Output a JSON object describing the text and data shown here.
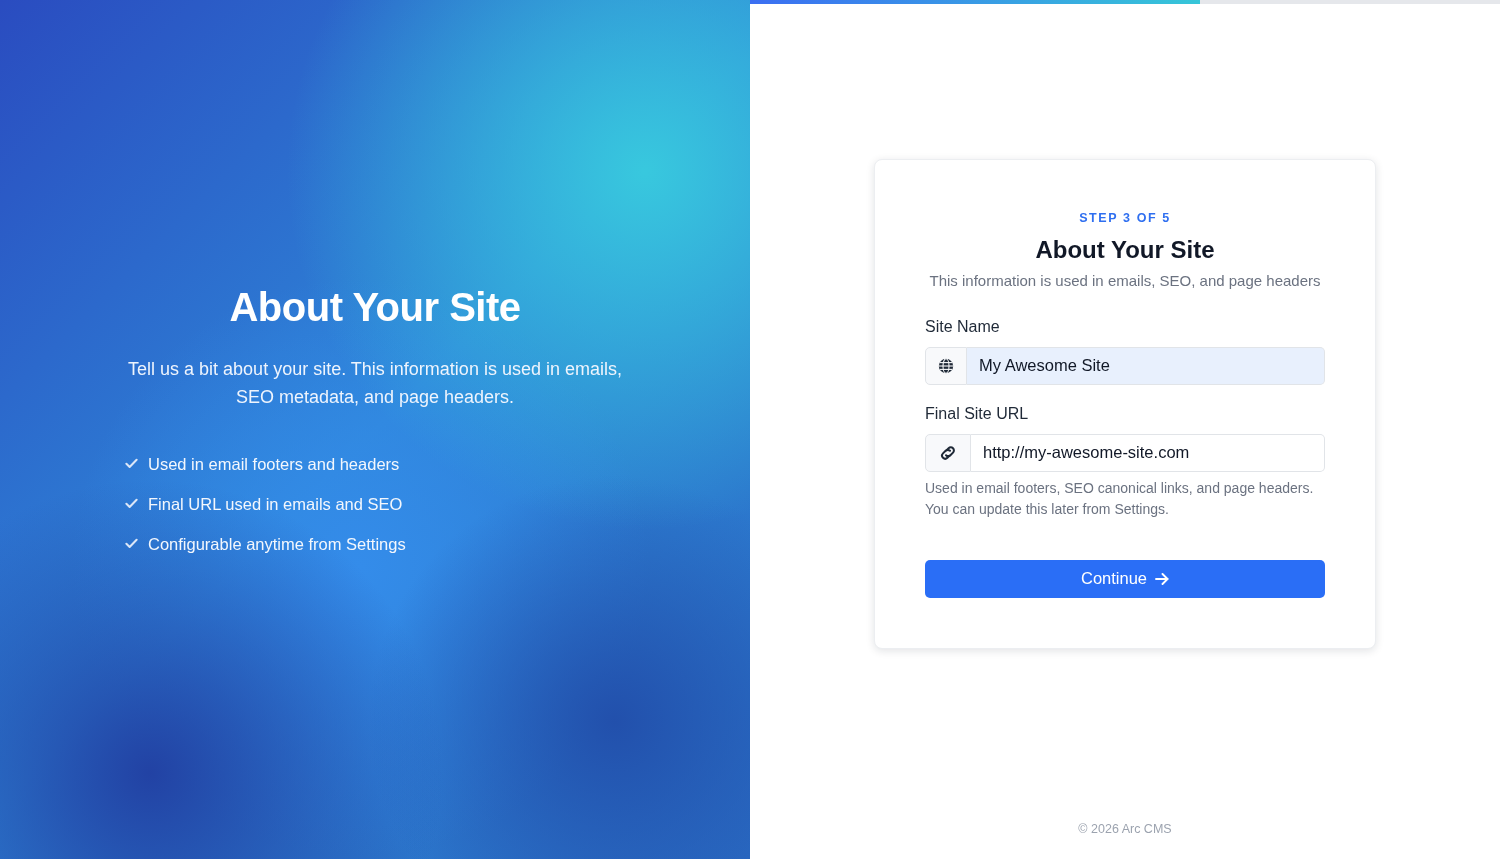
{
  "progress": {
    "level": 0.6
  },
  "hero": {
    "title": "About Your Site",
    "subtitle": "Tell us a bit about your site. This information is used in emails, SEO metadata, and page headers.",
    "features": [
      "Used in email footers and headers",
      "Final URL used in emails and SEO",
      "Configurable anytime from Settings"
    ]
  },
  "card": {
    "step": "STEP 3 OF 5",
    "title": "About Your Site",
    "subtitle": "This information is used in emails, SEO, and page headers",
    "fields": [
      {
        "label": "Site Name",
        "kind": "text",
        "value": "My Awesome Site",
        "autofilled": true
      },
      {
        "label": "Final Site URL",
        "kind": "url",
        "value": "http://my-awesome-site.com",
        "autofilled": false,
        "help": "Used in email footers, SEO canonical links, and page headers. You can update this later from Settings."
      }
    ],
    "button": "Continue"
  },
  "footer": "© 2026 Arc CMS"
}
